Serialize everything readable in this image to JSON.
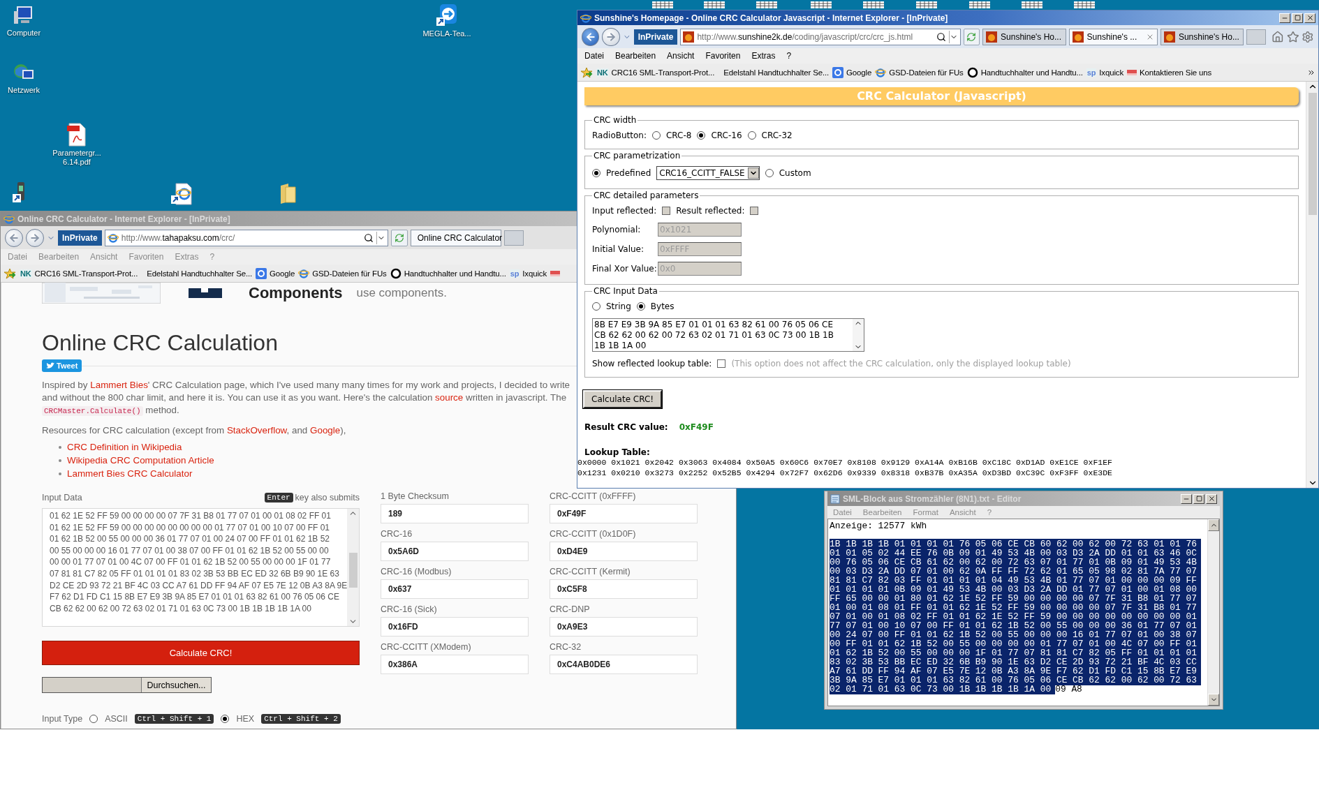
{
  "desktop": {
    "icons": [
      {
        "kind": "computer",
        "label": [
          "Computer"
        ]
      },
      {
        "kind": "network",
        "label": [
          "Netzwerk"
        ]
      },
      {
        "kind": "pdf",
        "label": [
          "Parametergr...",
          "6.14.pdf"
        ]
      },
      {
        "kind": "phone"
      },
      {
        "kind": "browser"
      },
      {
        "kind": "folder"
      },
      {
        "kind": "remote",
        "label": [
          "MEGLA-Tea..."
        ]
      }
    ]
  },
  "left_browser": {
    "active": false,
    "title": "Online CRC Calculator - Internet Explorer - [InPrivate]",
    "inprivate": "InPrivate",
    "url": {
      "prefix": "http://www.",
      "host": "tahapaksu.com",
      "path": "/crc/"
    },
    "tabs": [
      {
        "label": "Online CRC Calculator",
        "selected": true
      }
    ],
    "menu": [
      "Datei",
      "Bearbeiten",
      "Ansicht",
      "Favoriten",
      "Extras",
      "?"
    ],
    "favorites": [
      {
        "kind": "badge",
        "badge": "NK",
        "color": "#0b6e74",
        "label": "CRC16 SML-Transport-Prot..."
      },
      {
        "kind": "none",
        "label": "Edelstahl Handtuchhalter Se..."
      },
      {
        "kind": "google",
        "label": "Google"
      },
      {
        "kind": "ie",
        "label": "GSD-Dateien für FUs"
      },
      {
        "kind": "ring",
        "label": "Handtuchhalter und Handtu..."
      },
      {
        "kind": "badge",
        "badge": "sp",
        "color": "#5b7fd6",
        "label": "Ixquick"
      },
      {
        "kind": "red"
      }
    ],
    "page": {
      "banner": {
        "brand": "Components",
        "tagline": "use components."
      },
      "title": "Online CRC Calculation",
      "tweet": "Tweet",
      "intro": [
        [
          {
            "text": "Inspired by "
          },
          {
            "text": "Lammert Bies",
            "kind": "link"
          },
          {
            "text": "' CRC Calculation page, which I've used many many times for my work and projects, I decided to write"
          }
        ],
        [
          {
            "text": "and without the 800 char limit, and here it is. You can use it as you want. Here's the calculation "
          },
          {
            "text": "source",
            "kind": "link"
          },
          {
            "text": " written in javascript. The"
          }
        ],
        [
          {
            "text": "CRCMaster.Calculate()",
            "kind": "code"
          },
          {
            "text": " method."
          }
        ]
      ],
      "resources": [
        {
          "text": "Resources for CRC calculation (except from "
        },
        {
          "text": "StackOverflow",
          "kind": "link"
        },
        {
          "text": ", and "
        },
        {
          "text": "Google",
          "kind": "link"
        },
        {
          "text": "),"
        }
      ],
      "links": [
        "CRC Definition in Wikipedia",
        "Wikipedia CRC Computation Article",
        "Lammert Bies CRC Calculator"
      ],
      "input_label": "Input Data",
      "enter_key": "Enter",
      "enter_hint": "key also submits",
      "input_lines": [
        "01 62 1E 52 FF 59 00 00 00 00 07 7F 31 B8 01 77 07 01 00 01 08 02 FF 01",
        "01 62 1E 52 FF 59 00 00 00 00 00 00 00 00 01 77 07 01 00 10 07 00 FF 01",
        "01 62 1B 52 00 55 00 00 00 36 01 77 07 01 00 24 07 00 FF 01 01 62 1B 52",
        "00 55 00 00 00 16 01 77 07 01 00 38 07 00 FF 01 01 62 1B 52 00 55 00 00",
        "00 00 01 77 07 01 00 4C 07 00 FF 01 01 62 1B 52 00 55 00 00 00 1F 01 77",
        "07 81 81 C7 82 05 FF 01 01 01 01 83 02 3B 53 BB EC ED 32 6B B9 90 1E 63",
        "D2 CE 2D 93 72 21 BF 4C 03 CC A7 61 DD FF 94 AF 07 E5 7E 12 0B A3 8A 9E",
        "F7 62 D1 FD C1 15 8B E7 E9 3B 9A 85 E7 01 01 01 63 82 61 00 76 05 06 CE",
        "CB 62 62 00 62 00 72 63 02 01 71 01 63 0C 73 00 1B 1B 1B 1B 1A 00"
      ],
      "calculate": "Calculate CRC!",
      "browse": "Durchsuchen...",
      "input_type": {
        "label": "Input Type",
        "options": [
          {
            "label": "ASCII",
            "shortcut": "Ctrl + Shift + 1",
            "selected": false
          },
          {
            "label": "HEX",
            "shortcut": "Ctrl + Shift + 2",
            "selected": true
          }
        ]
      },
      "checksums": [
        {
          "label": "1 Byte Checksum",
          "value": "189"
        },
        {
          "label": "CRC-CCITT (0xFFFF)",
          "value": "0xF49F"
        },
        {
          "label": "CRC-16",
          "value": "0x5A6D"
        },
        {
          "label": "CRC-CCITT (0x1D0F)",
          "value": "0xD4E9"
        },
        {
          "label": "CRC-16 (Modbus)",
          "value": "0x637"
        },
        {
          "label": "CRC-CCITT (Kermit)",
          "value": "0xC5F8"
        },
        {
          "label": "CRC-16 (Sick)",
          "value": "0x16FD"
        },
        {
          "label": "CRC-DNP",
          "value": "0xA9E3"
        },
        {
          "label": "CRC-CCITT (XModem)",
          "value": "0x386A"
        },
        {
          "label": "CRC-32",
          "value": "0xC4AB0DE6"
        }
      ]
    }
  },
  "right_browser": {
    "active": true,
    "title": "Sunshine's Homepage - Online CRC Calculator Javascript - Internet Explorer - [InPrivate]",
    "inprivate": "InPrivate",
    "url": {
      "prefix": "http://www.",
      "host": "sunshine2k.de",
      "path": "/coding/javascript/crc/crc_js.html"
    },
    "tabs": [
      {
        "label": "Sunshine's Ho...",
        "selected": false
      },
      {
        "label": "Sunshine's ...",
        "selected": true
      },
      {
        "label": "Sunshine's Ho...",
        "selected": false
      }
    ],
    "menu": [
      "Datei",
      "Bearbeiten",
      "Ansicht",
      "Favoriten",
      "Extras",
      "?"
    ],
    "favorites": [
      {
        "kind": "badge",
        "badge": "NK",
        "color": "#0b6e74",
        "label": "CRC16 SML-Transport-Prot..."
      },
      {
        "kind": "none",
        "label": "Edelstahl Handtuchhalter Se..."
      },
      {
        "kind": "google",
        "label": "Google"
      },
      {
        "kind": "ie",
        "label": "GSD-Dateien für FUs"
      },
      {
        "kind": "ring",
        "label": "Handtuchhalter und Handtu..."
      },
      {
        "kind": "badge",
        "badge": "sp",
        "color": "#5b7fd6",
        "label": "Ixquick"
      },
      {
        "kind": "red",
        "label": "Kontaktieren Sie uns"
      }
    ],
    "page": {
      "header": "CRC Calculator (Javascript)",
      "crc_width": {
        "legend": "CRC width",
        "label": "RadioButton:",
        "options": [
          {
            "label": "CRC-8",
            "selected": false
          },
          {
            "label": "CRC-16",
            "selected": true
          },
          {
            "label": "CRC-32",
            "selected": false
          }
        ]
      },
      "parametrization": {
        "legend": "CRC parametrization",
        "predefined": {
          "label": "Predefined",
          "selected": true
        },
        "select": "CRC16_CCITT_FALSE",
        "custom": {
          "label": "Custom",
          "selected": false
        }
      },
      "detailed": {
        "legend": "CRC detailed parameters",
        "checks": [
          {
            "label": "Input reflected:",
            "checked": false
          },
          {
            "label": "Result reflected:",
            "checked": false
          }
        ],
        "fields": [
          {
            "label": "Polynomial:",
            "value": "0x1021",
            "disabled": true
          },
          {
            "label": "Initial Value:",
            "value": "0xFFFF",
            "disabled": true
          },
          {
            "label": "Final Xor Value:",
            "value": "0x0",
            "disabled": true
          }
        ]
      },
      "input": {
        "legend": "CRC Input Data",
        "options": [
          {
            "label": "String",
            "selected": false
          },
          {
            "label": "Bytes",
            "selected": true
          }
        ],
        "lines": [
          "8B E7 E9 3B 9A 85 E7 01 01 01 63 82 61 00 76 05 06 CE",
          "CB 62 62 00 62 00 72 63 02 01 71 01 63 0C 73 00 1B 1B",
          "1B 1B 1A 00"
        ],
        "reflected": {
          "label": "Show reflected lookup table:",
          "checked": false,
          "note": "(This option does not affect the CRC calculation, only the displayed lookup table)"
        }
      },
      "button": "Calculate CRC!",
      "result": {
        "label": "Result CRC value:",
        "value": "0xF49F"
      },
      "lookup": {
        "title": "Lookup Table:",
        "rows": [
          "0x0000 0x1021 0x2042 0x3063 0x4084 0x50A5 0x60C6 0x70E7 0x8108 0x9129 0xA14A 0xB16B 0xC18C 0xD1AD 0xE1CE 0xF1EF",
          "0x1231 0x0210 0x3273 0x2252 0x52B5 0x4294 0x72F7 0x62D6 0x9339 0x8318 0xB37B 0xA35A 0xD3BD 0xC39C 0xF3FF 0xE3DE"
        ]
      }
    }
  },
  "notepad": {
    "active": false,
    "title": "SML-Block aus Stromzähler (8N1).txt - Editor",
    "menu": [
      "Datei",
      "Bearbeiten",
      "Format",
      "Ansicht",
      "?"
    ],
    "heading": "Anzeige: 12577 kWh",
    "lines": [
      {
        "text": "1B 1B 1B 1B 01 01 01 01 76 05 06 CE CB 60 62 00 62 00 72 63 01 01 76",
        "selected": true
      },
      {
        "text": "01 01 05 02 44 EE 76 0B 09 01 49 53 4B 00 03 D3 2A DD 01 01 63 46 0C",
        "selected": true
      },
      {
        "text": "00 76 05 06 CE CB 61 62 00 62 00 72 63 07 01 77 01 0B 09 01 49 53 4B",
        "selected": true
      },
      {
        "text": "00 03 D3 2A DD 07 01 00 62 0A FF FF 72 62 01 65 05 98 02 81 7A 77 07",
        "selected": true
      },
      {
        "text": "81 81 C7 82 03 FF 01 01 01 01 04 49 53 4B 01 77 07 01 00 00 00 09 FF",
        "selected": true
      },
      {
        "text": "01 01 01 01 0B 09 01 49 53 4B 00 03 D3 2A DD 01 77 07 01 00 01 08 00",
        "selected": true
      },
      {
        "text": "FF 65 00 00 01 80 01 62 1E 52 FF 59 00 00 00 00 07 7F 31 B8 01 77 07",
        "selected": true
      },
      {
        "text": "01 00 01 08 01 FF 01 01 62 1E 52 FF 59 00 00 00 00 07 7F 31 B8 01 77",
        "selected": true
      },
      {
        "text": "07 01 00 01 08 02 FF 01 01 62 1E 52 FF 59 00 00 00 00 00 00 00 00 01",
        "selected": true
      },
      {
        "text": "77 07 01 00 10 07 00 FF 01 01 62 1B 52 00 55 00 00 00 36 01 77 07 01",
        "selected": true
      },
      {
        "text": "00 24 07 00 FF 01 01 62 1B 52 00 55 00 00 00 16 01 77 07 01 00 38 07",
        "selected": true
      },
      {
        "text": "00 FF 01 01 62 1B 52 00 55 00 00 00 00 01 77 07 01 00 4C 07 00 FF 01",
        "selected": true
      },
      {
        "text": "01 62 1B 52 00 55 00 00 00 1F 01 77 07 81 81 C7 82 05 FF 01 01 01 01",
        "selected": true
      },
      {
        "text": "83 02 3B 53 BB EC ED 32 6B B9 90 1E 63 D2 CE 2D 93 72 21 BF 4C 03 CC",
        "selected": true
      },
      {
        "text": "A7 61 DD FF 94 AF 07 E5 7E 12 0B A3 8A 9E F7 62 D1 FD C1 15 8B E7 E9",
        "selected": true
      },
      {
        "text": "3B 9A 85 E7 01 01 01 63 82 61 00 76 05 06 CE CB 62 62 00 62 00 72 63",
        "selected": true
      },
      {
        "text": "02 01 71 01 63 0C 73 00 1B 1B 1B 1B 1A 00",
        "selected": true
      },
      {
        "text": "09 A8",
        "selected": false
      }
    ]
  }
}
